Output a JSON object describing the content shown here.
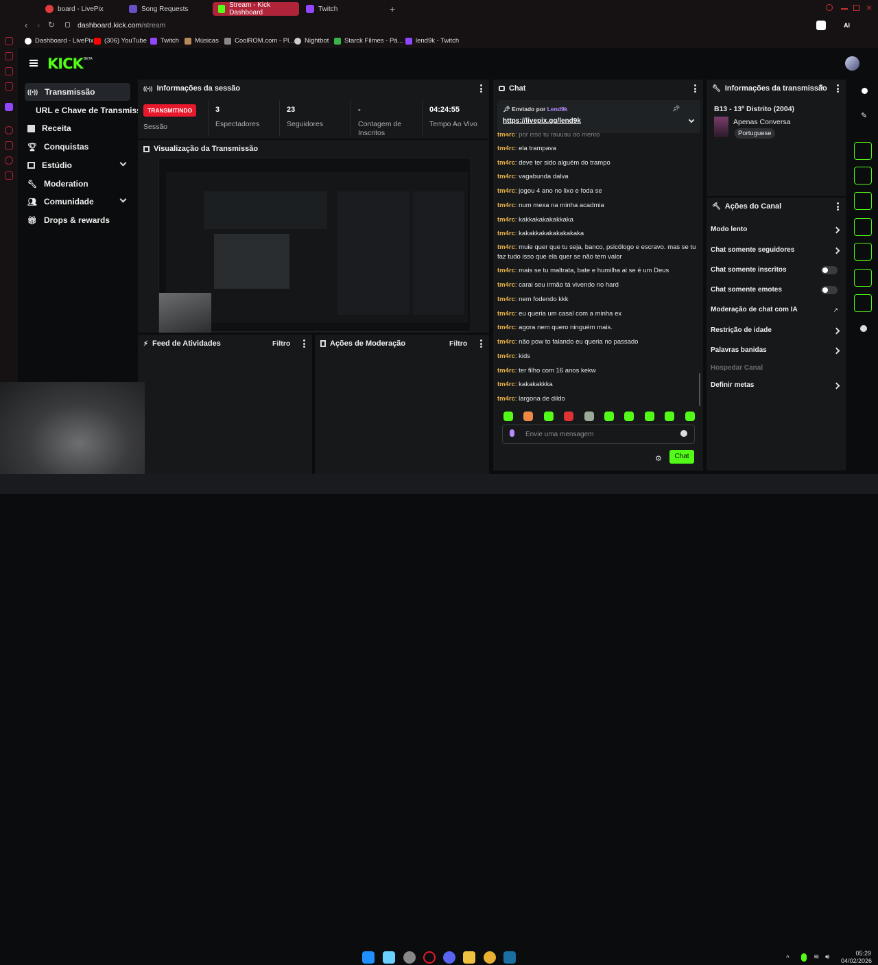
{
  "browser": {
    "tabs": [
      {
        "label": "board - LivePix",
        "active": false
      },
      {
        "label": "Song Requests",
        "active": false
      },
      {
        "label": "Stream - Kick Dashboard",
        "active": true
      },
      {
        "label": "Twitch",
        "active": false
      }
    ],
    "url_domain": "dashboard.kick.com",
    "url_path": "/stream",
    "bookmarks": [
      "Dashboard - LivePix",
      "(306) YouTube",
      "Twitch",
      "Músicas",
      "CoolROM.com - Pl...",
      "Nightbot",
      "Starck Filmes - Pá...",
      "lend9k - Twitch"
    ],
    "ai_label": "AI"
  },
  "sidebar": {
    "logo": "KICK",
    "logo_badge": "BETA",
    "items": [
      {
        "label": "Transmissão",
        "icon": "broadcast-icon"
      },
      {
        "label": "URL e Chave de Transmissão",
        "icon": ""
      },
      {
        "label": "Receita",
        "icon": "chart-icon"
      },
      {
        "label": "Conquistas",
        "icon": "trophy-icon"
      },
      {
        "label": "Estúdio",
        "icon": "studio-icon"
      },
      {
        "label": "Moderation",
        "icon": "wrench-icon"
      },
      {
        "label": "Comunidade",
        "icon": "people-icon"
      },
      {
        "label": "Drops & rewards",
        "icon": "gift-icon"
      }
    ]
  },
  "session": {
    "title": "Informações da sessão",
    "status_badge": "TRANSMITINDO",
    "status_label": "Sessão",
    "stats": [
      {
        "value": "3",
        "label": "Espectadores"
      },
      {
        "value": "23",
        "label": "Seguidores"
      },
      {
        "value": "-",
        "label": "Contagem de Inscritos"
      },
      {
        "value": "04:24:55",
        "label": "Tempo Ao Vivo"
      }
    ]
  },
  "preview": {
    "title": "Visualização da Transmissão"
  },
  "activity": {
    "title": "Feed de Atividades",
    "filter": "Filtro"
  },
  "moderation": {
    "title": "Ações de Moderação",
    "filter": "Filtro"
  },
  "chat": {
    "title": "Chat",
    "pinned_label": "Enviado por",
    "pinned_user": "Lend9k",
    "pinned_link": "https://livepix.gg/lend9k",
    "partial_line": "por isso tu rauuau do mento",
    "messages": [
      {
        "user": "tm4rc",
        "text": "ela trampava"
      },
      {
        "user": "tm4rc",
        "text": "deve ter sido alguém do trampo"
      },
      {
        "user": "tm4rc",
        "text": "vagabunda dalva"
      },
      {
        "user": "tm4rc",
        "text": "jogou 4 ano no lixo e foda se"
      },
      {
        "user": "tm4rc",
        "text": "num mexa na minha acadmia"
      },
      {
        "user": "tm4rc",
        "text": "kakkakakakakkaka"
      },
      {
        "user": "tm4rc",
        "text": "kakakkakakakakakaka"
      },
      {
        "user": "tm4rc",
        "text": "muie quer que tu seja, banco, psicólogo e escravo. mas se tu faz tudo isso que ela quer se não tem valor"
      },
      {
        "user": "tm4rc",
        "text": "mais se tu maltrata, bate e humilha ai se é um Deus"
      },
      {
        "user": "tm4rc",
        "text": "carai seu irmão tá vivendo no hard"
      },
      {
        "user": "tm4rc",
        "text": "nem fodendo kkk"
      },
      {
        "user": "tm4rc",
        "text": "eu queria um casal com a minha ex"
      },
      {
        "user": "tm4rc",
        "text": "agora nem quero ninguém mais."
      },
      {
        "user": "tm4rc",
        "text": "não pow to falando eu queria no passado"
      },
      {
        "user": "tm4rc",
        "text": "kids"
      },
      {
        "user": "tm4rc",
        "text": "ter filho com 16 anos kekw"
      },
      {
        "user": "tm4rc",
        "text": "kakakakkka"
      },
      {
        "user": "tm4rc",
        "text": "largona de dildo"
      }
    ],
    "input_placeholder": "Envie uma mensagem",
    "send_label": "Chat"
  },
  "stream_info": {
    "title": "Informações da transmissão",
    "stream_title": "B13 - 13º Distrito (2004)",
    "category": "Apenas Conversa",
    "language": "Portuguese"
  },
  "channel_actions": {
    "title": "Ações do Canal",
    "items": [
      {
        "label": "Modo lento",
        "control": "chevron"
      },
      {
        "label": "Chat somente seguidores",
        "control": "chevron"
      },
      {
        "label": "Chat somente inscritos",
        "control": "toggle"
      },
      {
        "label": "Chat somente emotes",
        "control": "toggle"
      },
      {
        "label": "Moderação de chat com IA",
        "control": "external"
      },
      {
        "label": "Restrição de idade",
        "control": "chevron"
      },
      {
        "label": "Palavras banidas",
        "control": "chevron"
      },
      {
        "label": "Hospedar Canal",
        "control": "disabled"
      },
      {
        "label": "Definir metas",
        "control": "chevron"
      }
    ]
  },
  "taskbar": {
    "time": "05:29",
    "date": "04/02/2026"
  },
  "colors": {
    "kick_green": "#53fc18",
    "live_red": "#e8192c",
    "username": "#e8b24a",
    "tab_active": "#b0243a"
  }
}
